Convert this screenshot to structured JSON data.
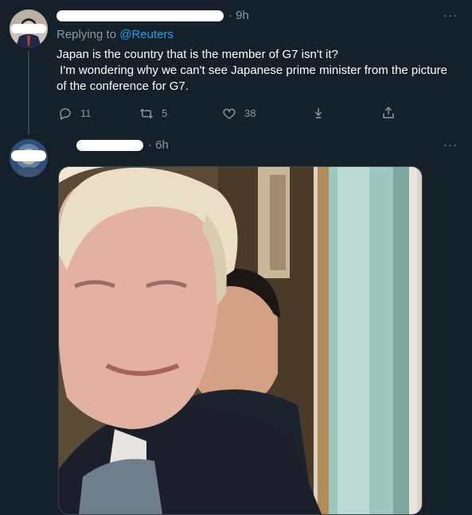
{
  "tweet1": {
    "timestamp": "· 9h",
    "more_label": "···",
    "replying_prefix": "Replying to ",
    "replying_handle": "@Reuters",
    "text_line1": "Japan is the country that is the member of G7 isn't it?",
    "text_line2": " I'm wondering why we can't see Japanese prime minister from the picture of the conference for G7.",
    "actions": {
      "reply_count": "11",
      "retweet_count": "5",
      "like_count": "38"
    },
    "icons": [
      "reply-icon",
      "retweet-icon",
      "heart-icon",
      "share-down-icon",
      "share-icon"
    ]
  },
  "tweet2": {
    "timestamp": "· 6h",
    "more_label": "···",
    "image_alt": "Photo of two men seated closely; a blond-haired man in a dark suit in front and a dark-haired man behind him"
  },
  "colors": {
    "background": "#15202b",
    "muted": "#8899a6",
    "link": "#1da1f2",
    "divider": "#38444d"
  }
}
